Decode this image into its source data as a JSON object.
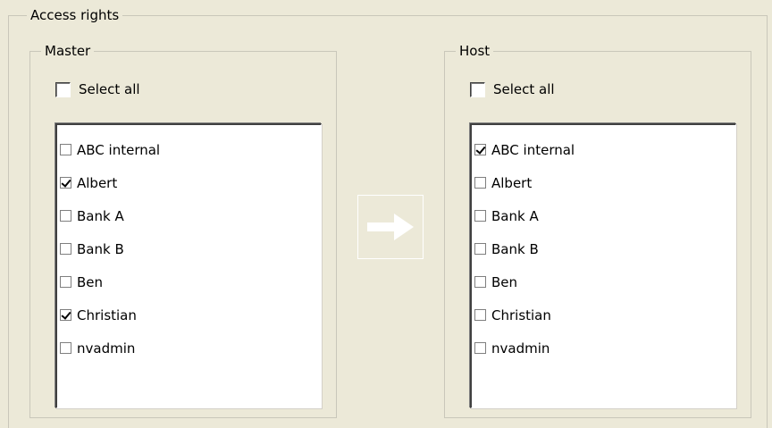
{
  "access_rights": {
    "title": "Access rights"
  },
  "master": {
    "title": "Master",
    "select_all_label": "Select all",
    "select_all_checked": false,
    "items": [
      {
        "label": "ABC internal",
        "checked": false
      },
      {
        "label": "Albert",
        "checked": true
      },
      {
        "label": "Bank A",
        "checked": false
      },
      {
        "label": "Bank B",
        "checked": false
      },
      {
        "label": "Ben",
        "checked": false
      },
      {
        "label": "Christian",
        "checked": true
      },
      {
        "label": "nvadmin",
        "checked": false
      }
    ]
  },
  "host": {
    "title": "Host",
    "select_all_label": "Select all",
    "select_all_checked": false,
    "items": [
      {
        "label": "ABC internal",
        "checked": true
      },
      {
        "label": "Albert",
        "checked": false
      },
      {
        "label": "Bank A",
        "checked": false
      },
      {
        "label": "Bank B",
        "checked": false
      },
      {
        "label": "Ben",
        "checked": false
      },
      {
        "label": "Christian",
        "checked": false
      },
      {
        "label": "nvadmin",
        "checked": false
      }
    ]
  },
  "transfer_button": {
    "icon": "arrow-right-icon"
  }
}
